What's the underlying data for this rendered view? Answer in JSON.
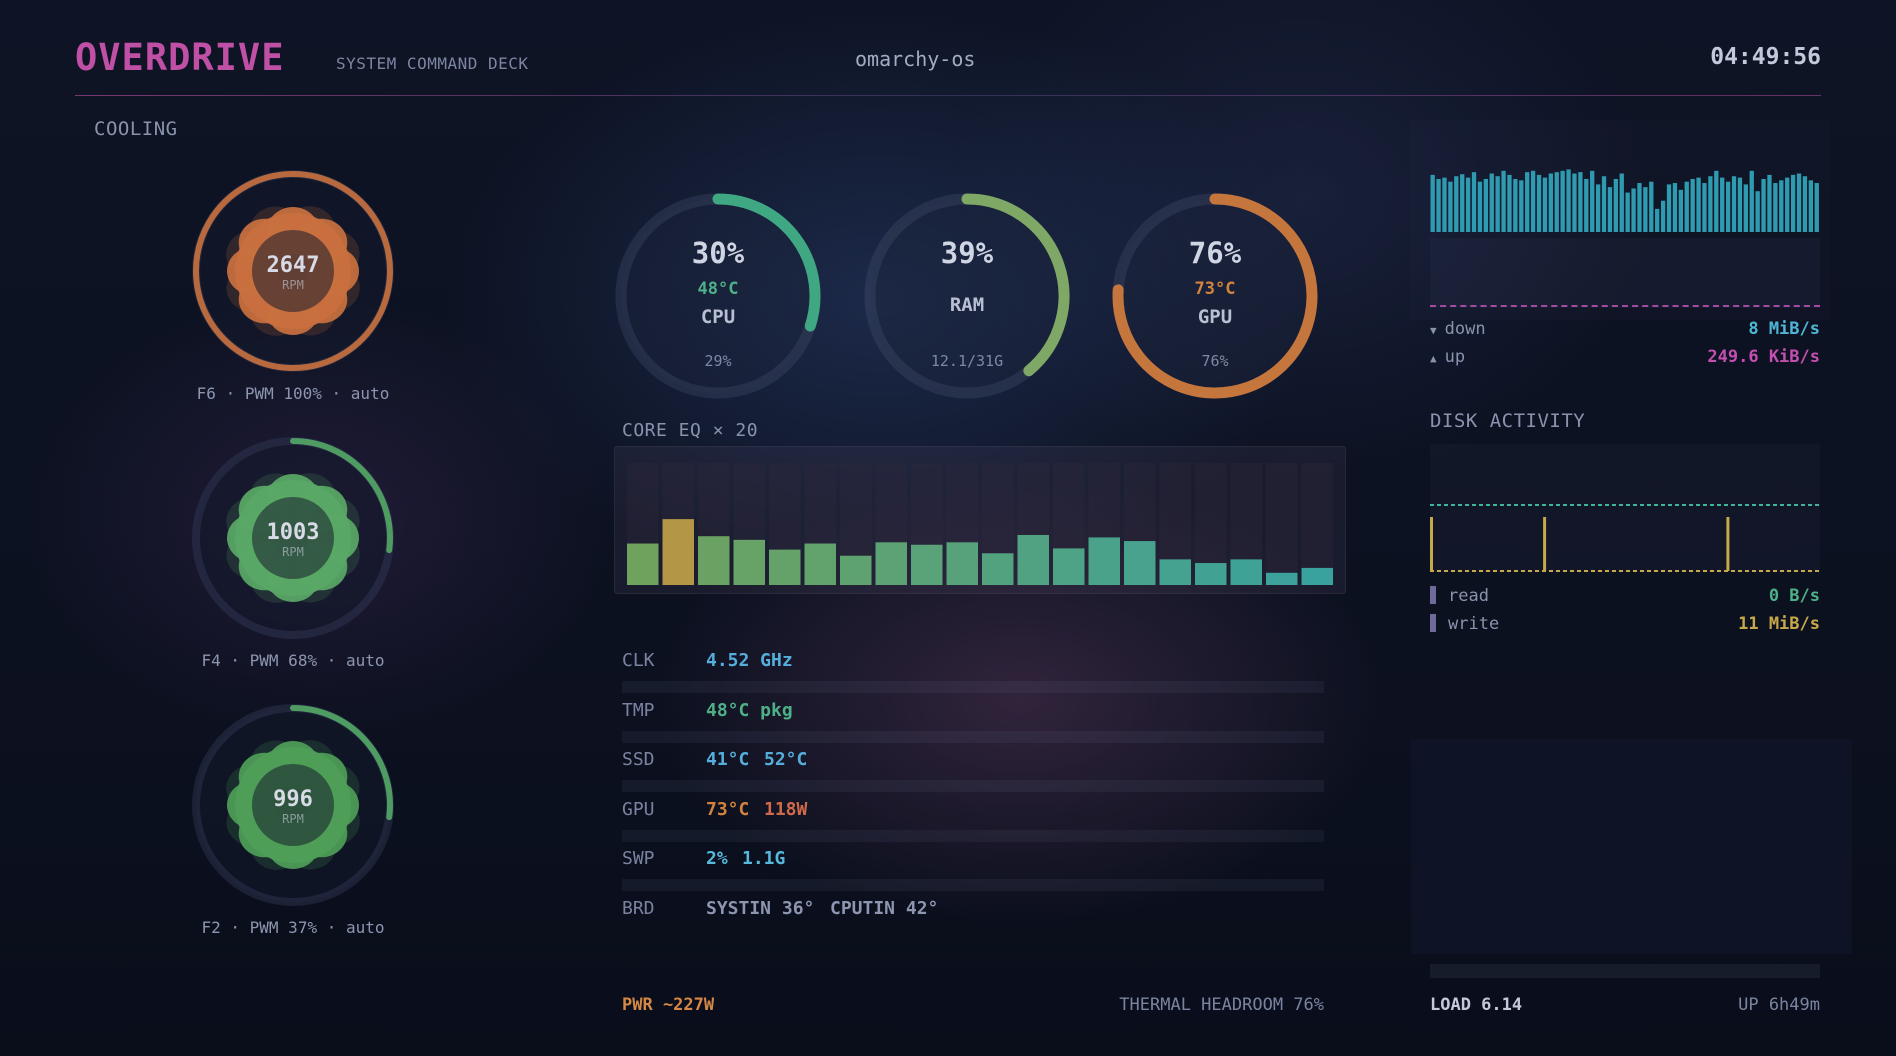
{
  "header": {
    "title": "OVERDRIVE",
    "subtitle": "SYSTEM COMMAND DECK",
    "hostname": "omarchy-os",
    "clock": "04:49:56"
  },
  "cooling": {
    "label": "COOLING",
    "fans": [
      {
        "rpm": "2647",
        "unit": "RPM",
        "caption": "F6 · PWM 100% · auto",
        "duty": 1.0,
        "color": "#c9703f",
        "arc_color": "#b8693e"
      },
      {
        "rpm": "1003",
        "unit": "RPM",
        "caption": "F4 · PWM 68% · auto",
        "duty": 0.27,
        "color": "#5aa866",
        "arc_color": "#4f9c63"
      },
      {
        "rpm": "996",
        "unit": "RPM",
        "caption": "F2 · PWM 37% · auto",
        "duty": 0.27,
        "color": "#4e9e58",
        "arc_color": "#4f9c63"
      }
    ]
  },
  "gauges": [
    {
      "percent": "30%",
      "temp": "48°C",
      "name": "CPU",
      "sub": "29%",
      "fraction": 0.3,
      "color": "#3fa882",
      "temp_color": "#4fb088"
    },
    {
      "percent": "39%",
      "temp": "",
      "name": "RAM",
      "sub": "12.1/31G",
      "fraction": 0.39,
      "color": "#7fa866",
      "temp_color": "#7fa866"
    },
    {
      "percent": "76%",
      "temp": "73°C",
      "name": "GPU",
      "sub": "76%",
      "fraction": 0.76,
      "color": "#c5763d",
      "temp_color": "#d4833f"
    }
  ],
  "core_eq": {
    "label": "CORE EQ × 20",
    "levels": [
      0.34,
      0.54,
      0.4,
      0.37,
      0.29,
      0.34,
      0.24,
      0.35,
      0.33,
      0.35,
      0.26,
      0.41,
      0.3,
      0.39,
      0.36,
      0.21,
      0.18,
      0.21,
      0.1,
      0.14
    ]
  },
  "stats": [
    {
      "key": "CLK",
      "values": [
        "4.52 GHz"
      ],
      "colors": [
        "#55aedc"
      ],
      "level": 0
    },
    {
      "key": "TMP",
      "values": [
        "48°C pkg"
      ],
      "colors": [
        "#4fb088"
      ],
      "level": 0
    },
    {
      "key": "SSD",
      "values": [
        "41°C",
        "52°C"
      ],
      "colors": [
        "#55aedc",
        "#55aedc"
      ],
      "level": 0
    },
    {
      "key": "GPU",
      "values": [
        "73°C",
        "118W"
      ],
      "colors": [
        "#d4833f",
        "#d06a4a"
      ],
      "level": 0
    },
    {
      "key": "SWP",
      "values": [
        "2%",
        "1.1G"
      ],
      "colors": [
        "#55b8dc",
        "#55b8dc"
      ],
      "level": 0
    },
    {
      "key": "BRD",
      "values": [
        "SYSTIN 36°",
        "CPUTIN 42°"
      ],
      "colors": [
        "#8d96b0",
        "#8d96b0"
      ],
      "level": null
    }
  ],
  "footer_left": {
    "power": "PWR ~227W",
    "headroom": "THERMAL HEADROOM 76%"
  },
  "network": {
    "bar_color": "#2e9bb0",
    "down_arrow": "▼",
    "up_arrow": "▲",
    "down_label": "down",
    "down_value": "8 MiB/s",
    "down_color": "#4fb6d6",
    "up_label": "up",
    "up_value": "249.6 KiB/s",
    "up_color": "#c44fb0",
    "activity": [
      0.84,
      0.78,
      0.8,
      0.74,
      0.82,
      0.85,
      0.8,
      0.88,
      0.74,
      0.78,
      0.86,
      0.82,
      0.9,
      0.84,
      0.78,
      0.76,
      0.88,
      0.9,
      0.84,
      0.8,
      0.86,
      0.88,
      0.9,
      0.92,
      0.86,
      0.88,
      0.78,
      0.9,
      0.7,
      0.82,
      0.66,
      0.78,
      0.86,
      0.58,
      0.64,
      0.72,
      0.66,
      0.74,
      0.34,
      0.46,
      0.7,
      0.72,
      0.62,
      0.74,
      0.78,
      0.8,
      0.72,
      0.82,
      0.9,
      0.8,
      0.74,
      0.82,
      0.8,
      0.7,
      0.9,
      0.6,
      0.78,
      0.84,
      0.72,
      0.76,
      0.8,
      0.84,
      0.86,
      0.82,
      0.76,
      0.72
    ]
  },
  "disk": {
    "label": "DISK ACTIVITY",
    "read_label": "read",
    "read_value": "0 B/s",
    "read_color": "#4fb088",
    "write_label": "write",
    "write_value": "11 MiB/s",
    "write_color": "#c8a94a",
    "spikes": [
      0.0,
      0.29,
      0.76
    ]
  },
  "footer_right": {
    "load": "LOAD 6.14",
    "uptime": "UP 6h49m"
  }
}
